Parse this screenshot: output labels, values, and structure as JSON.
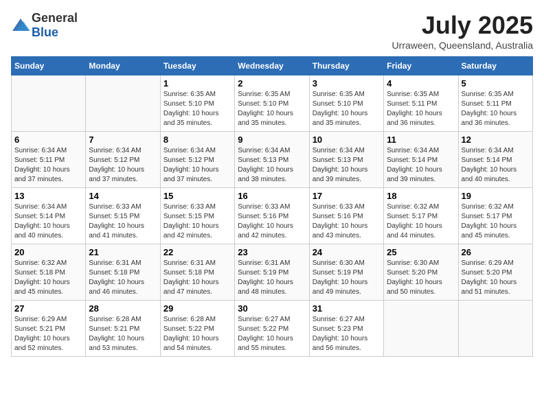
{
  "header": {
    "logo_general": "General",
    "logo_blue": "Blue",
    "month_year": "July 2025",
    "location": "Urraween, Queensland, Australia"
  },
  "weekdays": [
    "Sunday",
    "Monday",
    "Tuesday",
    "Wednesday",
    "Thursday",
    "Friday",
    "Saturday"
  ],
  "weeks": [
    [
      {
        "day": "",
        "info": ""
      },
      {
        "day": "",
        "info": ""
      },
      {
        "day": "1",
        "sunrise": "6:35 AM",
        "sunset": "5:10 PM",
        "daylight": "10 hours and 35 minutes."
      },
      {
        "day": "2",
        "sunrise": "6:35 AM",
        "sunset": "5:10 PM",
        "daylight": "10 hours and 35 minutes."
      },
      {
        "day": "3",
        "sunrise": "6:35 AM",
        "sunset": "5:10 PM",
        "daylight": "10 hours and 35 minutes."
      },
      {
        "day": "4",
        "sunrise": "6:35 AM",
        "sunset": "5:11 PM",
        "daylight": "10 hours and 36 minutes."
      },
      {
        "day": "5",
        "sunrise": "6:35 AM",
        "sunset": "5:11 PM",
        "daylight": "10 hours and 36 minutes."
      }
    ],
    [
      {
        "day": "6",
        "sunrise": "6:34 AM",
        "sunset": "5:11 PM",
        "daylight": "10 hours and 37 minutes."
      },
      {
        "day": "7",
        "sunrise": "6:34 AM",
        "sunset": "5:12 PM",
        "daylight": "10 hours and 37 minutes."
      },
      {
        "day": "8",
        "sunrise": "6:34 AM",
        "sunset": "5:12 PM",
        "daylight": "10 hours and 37 minutes."
      },
      {
        "day": "9",
        "sunrise": "6:34 AM",
        "sunset": "5:13 PM",
        "daylight": "10 hours and 38 minutes."
      },
      {
        "day": "10",
        "sunrise": "6:34 AM",
        "sunset": "5:13 PM",
        "daylight": "10 hours and 39 minutes."
      },
      {
        "day": "11",
        "sunrise": "6:34 AM",
        "sunset": "5:14 PM",
        "daylight": "10 hours and 39 minutes."
      },
      {
        "day": "12",
        "sunrise": "6:34 AM",
        "sunset": "5:14 PM",
        "daylight": "10 hours and 40 minutes."
      }
    ],
    [
      {
        "day": "13",
        "sunrise": "6:34 AM",
        "sunset": "5:14 PM",
        "daylight": "10 hours and 40 minutes."
      },
      {
        "day": "14",
        "sunrise": "6:33 AM",
        "sunset": "5:15 PM",
        "daylight": "10 hours and 41 minutes."
      },
      {
        "day": "15",
        "sunrise": "6:33 AM",
        "sunset": "5:15 PM",
        "daylight": "10 hours and 42 minutes."
      },
      {
        "day": "16",
        "sunrise": "6:33 AM",
        "sunset": "5:16 PM",
        "daylight": "10 hours and 42 minutes."
      },
      {
        "day": "17",
        "sunrise": "6:33 AM",
        "sunset": "5:16 PM",
        "daylight": "10 hours and 43 minutes."
      },
      {
        "day": "18",
        "sunrise": "6:32 AM",
        "sunset": "5:17 PM",
        "daylight": "10 hours and 44 minutes."
      },
      {
        "day": "19",
        "sunrise": "6:32 AM",
        "sunset": "5:17 PM",
        "daylight": "10 hours and 45 minutes."
      }
    ],
    [
      {
        "day": "20",
        "sunrise": "6:32 AM",
        "sunset": "5:18 PM",
        "daylight": "10 hours and 45 minutes."
      },
      {
        "day": "21",
        "sunrise": "6:31 AM",
        "sunset": "5:18 PM",
        "daylight": "10 hours and 46 minutes."
      },
      {
        "day": "22",
        "sunrise": "6:31 AM",
        "sunset": "5:18 PM",
        "daylight": "10 hours and 47 minutes."
      },
      {
        "day": "23",
        "sunrise": "6:31 AM",
        "sunset": "5:19 PM",
        "daylight": "10 hours and 48 minutes."
      },
      {
        "day": "24",
        "sunrise": "6:30 AM",
        "sunset": "5:19 PM",
        "daylight": "10 hours and 49 minutes."
      },
      {
        "day": "25",
        "sunrise": "6:30 AM",
        "sunset": "5:20 PM",
        "daylight": "10 hours and 50 minutes."
      },
      {
        "day": "26",
        "sunrise": "6:29 AM",
        "sunset": "5:20 PM",
        "daylight": "10 hours and 51 minutes."
      }
    ],
    [
      {
        "day": "27",
        "sunrise": "6:29 AM",
        "sunset": "5:21 PM",
        "daylight": "10 hours and 52 minutes."
      },
      {
        "day": "28",
        "sunrise": "6:28 AM",
        "sunset": "5:21 PM",
        "daylight": "10 hours and 53 minutes."
      },
      {
        "day": "29",
        "sunrise": "6:28 AM",
        "sunset": "5:22 PM",
        "daylight": "10 hours and 54 minutes."
      },
      {
        "day": "30",
        "sunrise": "6:27 AM",
        "sunset": "5:22 PM",
        "daylight": "10 hours and 55 minutes."
      },
      {
        "day": "31",
        "sunrise": "6:27 AM",
        "sunset": "5:23 PM",
        "daylight": "10 hours and 56 minutes."
      },
      {
        "day": "",
        "info": ""
      },
      {
        "day": "",
        "info": ""
      }
    ]
  ]
}
